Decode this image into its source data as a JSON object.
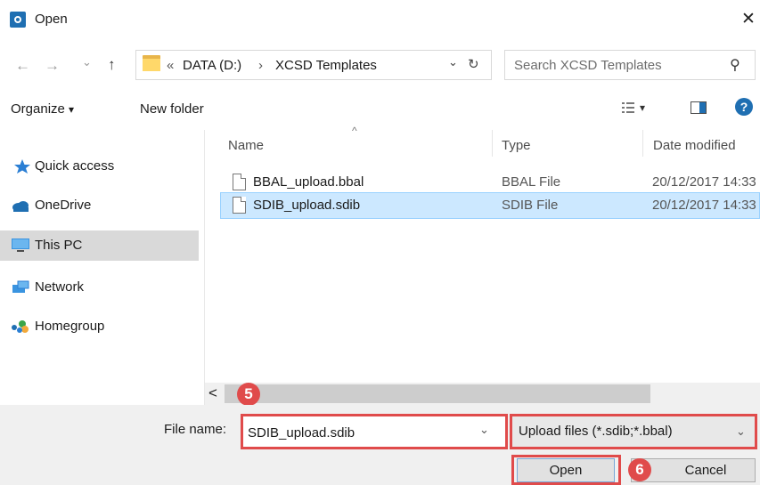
{
  "window": {
    "title": "Open",
    "close_glyph": "✕"
  },
  "nav": {
    "back_glyph": "←",
    "forward_glyph": "→",
    "recent_glyph": "⌄",
    "up_glyph": "↑",
    "overflow": "«",
    "breadcrumb": [
      "DATA (D:)",
      "XCSD Templates"
    ],
    "separator": "›",
    "dropdown_glyph": "⌄",
    "refresh_glyph": "↻",
    "search_placeholder": "Search XCSD Templates",
    "search_glyph": "⚲"
  },
  "toolbar": {
    "organize_label": "Organize",
    "organize_caret": "▾",
    "new_folder_label": "New folder",
    "view_caret": "▾",
    "help_glyph": "?"
  },
  "sidebar": {
    "items": [
      {
        "label": "Quick access",
        "icon": "star-icon"
      },
      {
        "label": "OneDrive",
        "icon": "cloud-icon"
      },
      {
        "label": "This PC",
        "icon": "monitor-icon",
        "selected": true
      },
      {
        "label": "Network",
        "icon": "network-icon"
      },
      {
        "label": "Homegroup",
        "icon": "homegroup-icon"
      }
    ]
  },
  "file_list": {
    "sort_caret": "^",
    "columns": [
      "Name",
      "Type",
      "Date modified"
    ],
    "rows": [
      {
        "name": "BBAL_upload.bbal",
        "type": "BBAL File",
        "date": "20/12/2017 14:33"
      },
      {
        "name": "SDIB_upload.sdib",
        "type": "SDIB File",
        "date": "20/12/2017 14:33",
        "selected": true
      }
    ]
  },
  "scrollbar": {
    "left_glyph": "<"
  },
  "footer": {
    "file_name_label": "File name:",
    "file_name_value": "SDIB_upload.sdib",
    "file_type_value": "Upload files (*.sdib;*.bbal)",
    "dropdown_glyph": "⌄",
    "open_label": "Open",
    "cancel_label": "Cancel"
  },
  "annotations": {
    "step5": "5",
    "step6": "6"
  },
  "colors": {
    "highlight": "#e04b4b",
    "selection": "#cce8ff",
    "accent": "#1f6fb2"
  }
}
